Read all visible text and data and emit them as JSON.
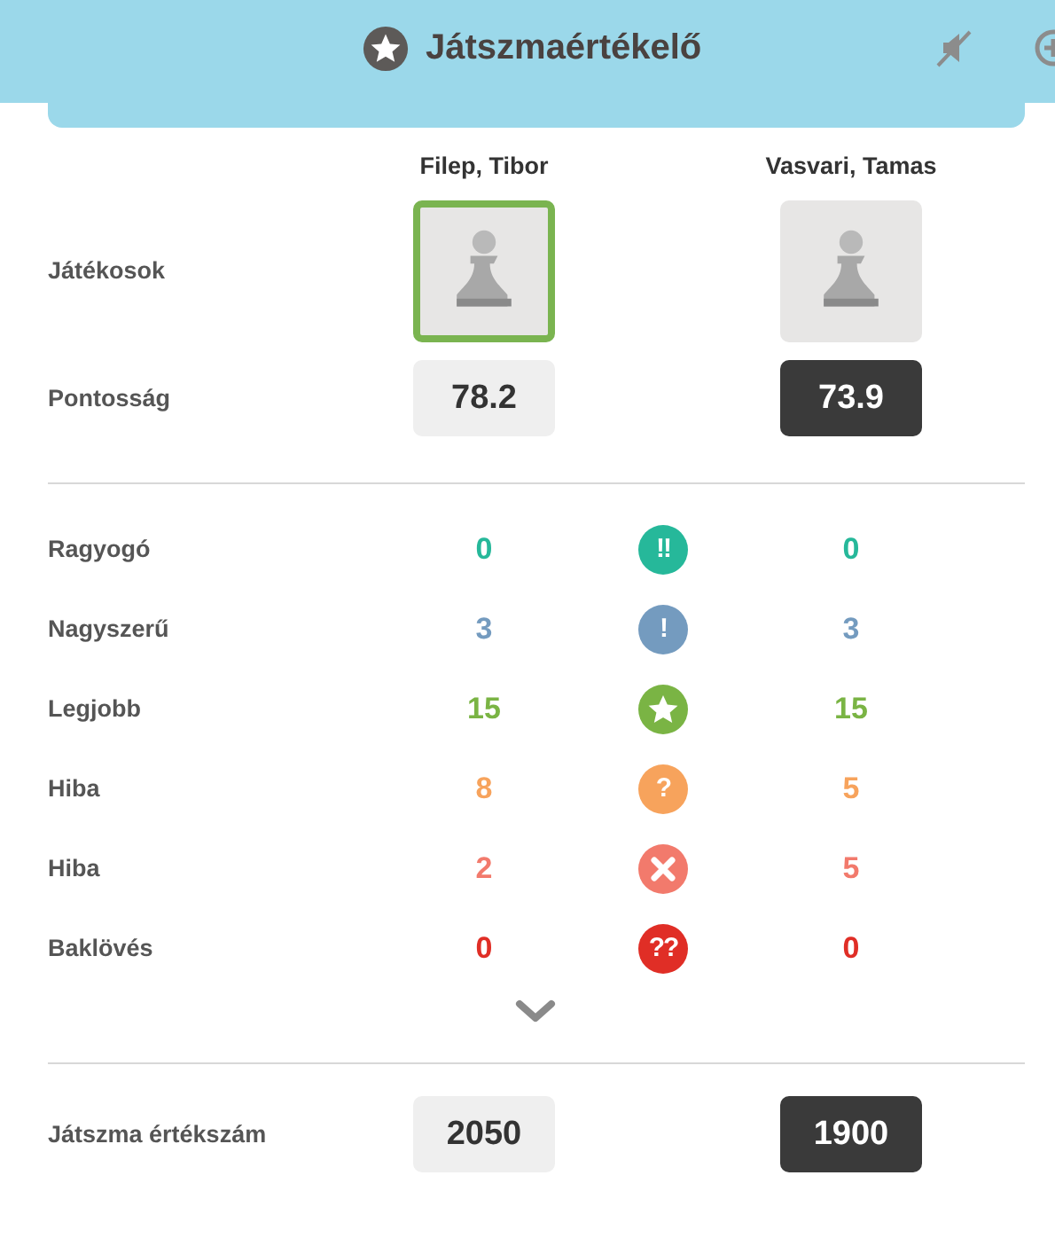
{
  "header": {
    "title": "Játszmaértékelő"
  },
  "players_label": "Játékosok",
  "accuracy_label": "Pontosság",
  "rating_label": "Játszma értékszám",
  "players": [
    {
      "name": "Filep, Tibor",
      "selected": true,
      "dark": false,
      "accuracy": "78.2",
      "rating": "2050"
    },
    {
      "name": "Vasvari, Tamas",
      "selected": false,
      "dark": true,
      "accuracy": "73.9",
      "rating": "1900"
    }
  ],
  "moves": [
    {
      "label": "Ragyogó",
      "kind": "text",
      "symbol": "!!",
      "color": "#26b89a",
      "white": "0",
      "black": "0"
    },
    {
      "label": "Nagyszerű",
      "kind": "text",
      "symbol": "!",
      "color": "#749bbf",
      "white": "3",
      "black": "3"
    },
    {
      "label": "Legjobb",
      "kind": "star",
      "color": "#7ab444",
      "white": "15",
      "black": "15"
    },
    {
      "label": "Hiba",
      "kind": "text",
      "symbol": "?",
      "color": "#f7a35c",
      "white": "8",
      "black": "5"
    },
    {
      "label": "Hiba",
      "kind": "cross",
      "color": "#f27a6c",
      "white": "2",
      "black": "5"
    },
    {
      "label": "Baklövés",
      "kind": "text",
      "symbol": "??",
      "color": "#e02e26",
      "white": "0",
      "black": "0"
    }
  ]
}
